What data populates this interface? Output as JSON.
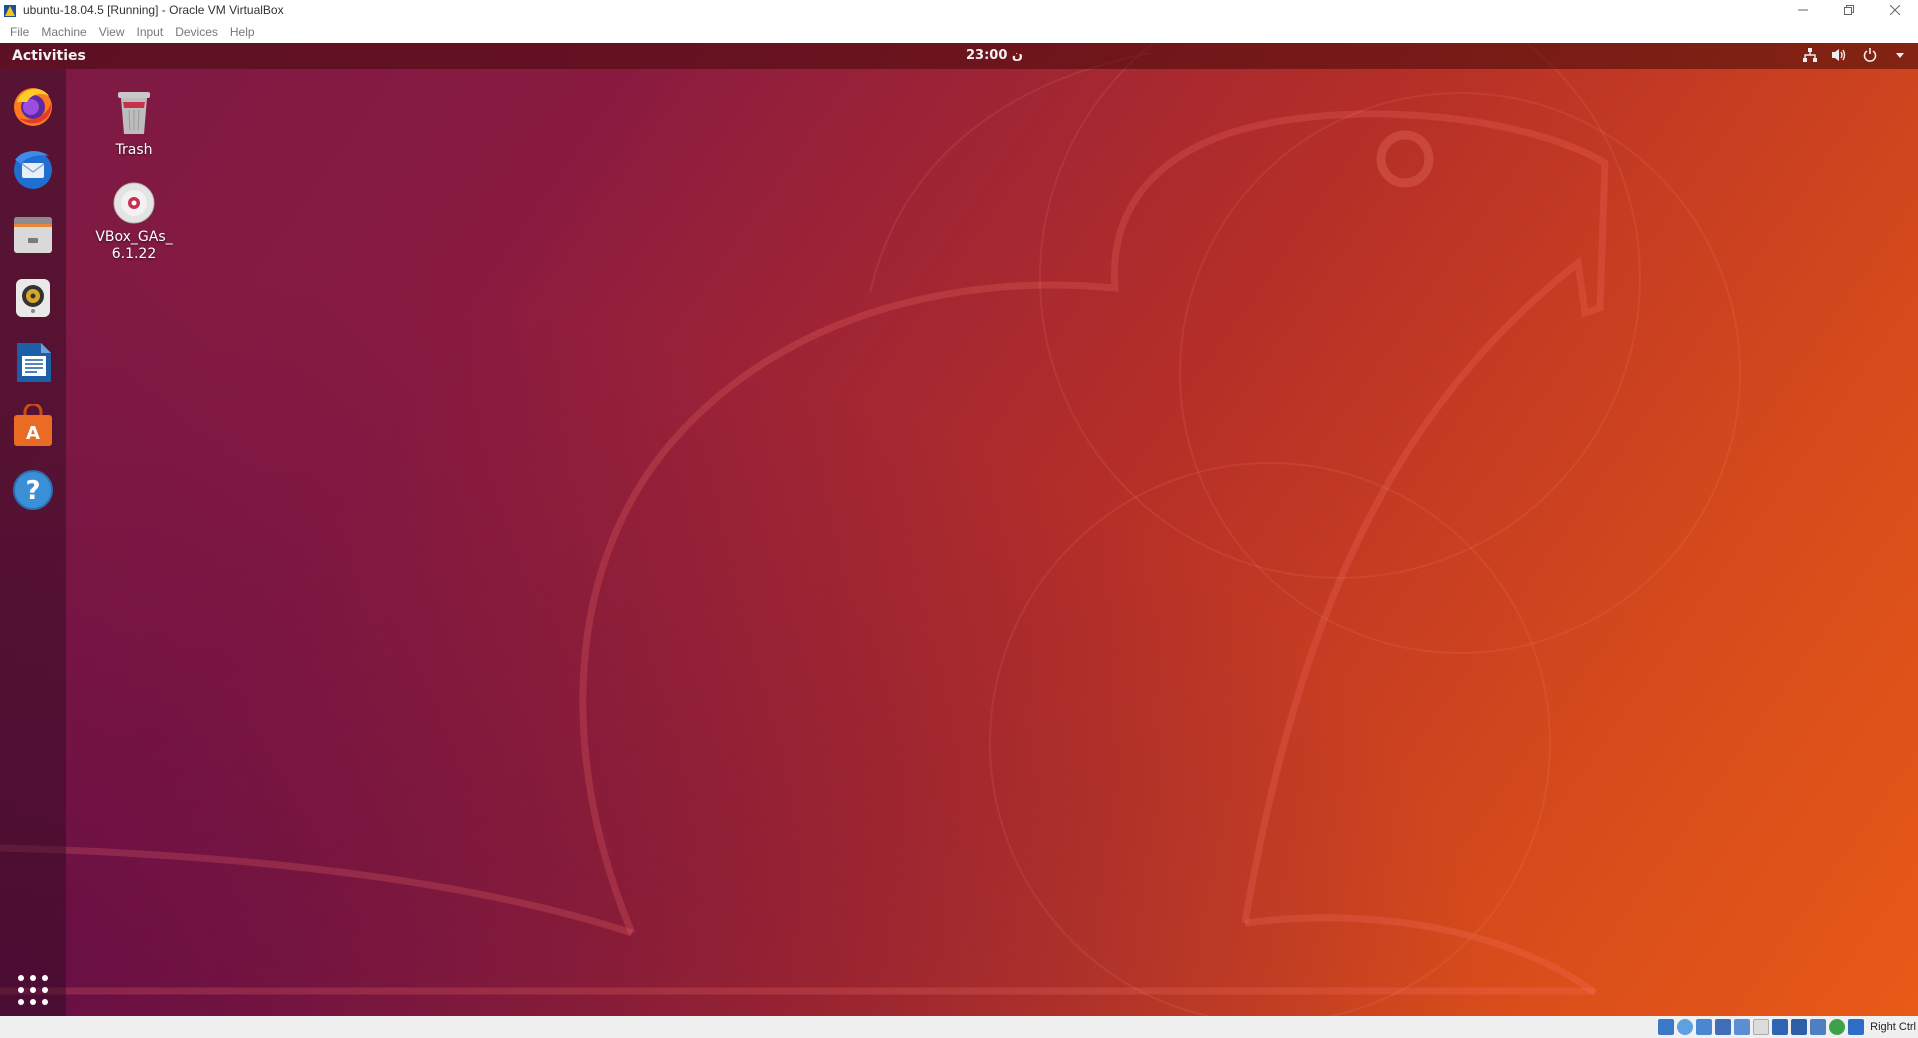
{
  "window": {
    "title": "ubuntu-18.04.5 [Running] - Oracle VM VirtualBox",
    "controls": [
      "minimize-icon",
      "restore-icon",
      "close-icon"
    ]
  },
  "menubar": {
    "items": [
      "File",
      "Machine",
      "View",
      "Input",
      "Devices",
      "Help"
    ]
  },
  "topbar": {
    "activities": "Activities",
    "clock": "23:00 ن",
    "tray_icons": [
      "network-icon",
      "volume-icon",
      "power-icon",
      "chevron-down-icon"
    ]
  },
  "dock": {
    "items": [
      "firefox-icon",
      "thunderbird-icon",
      "files-icon",
      "rhythmbox-icon",
      "libreoffice-writer-icon",
      "software-center-icon",
      "help-icon"
    ],
    "show_apps": "app-grid-icon"
  },
  "desktop": {
    "icons": [
      {
        "label": "Trash",
        "icon": "trash-icon"
      },
      {
        "label": "VBox_GAs_\n6.1.22",
        "icon": "cd-icon"
      }
    ]
  },
  "statusbar": {
    "host_key": "Right Ctrl",
    "icons": [
      "hdd-icon",
      "optical-icon",
      "audio-icon",
      "network-status-icon",
      "usb-icon",
      "shared-folders-icon",
      "display-icon",
      "video-capture-icon",
      "cpu-icon",
      "mouse-integration-icon",
      "host-key-icon"
    ]
  },
  "colors": {
    "wallpaper_start": "#7b1a45",
    "wallpaper_end": "#e85a17"
  }
}
